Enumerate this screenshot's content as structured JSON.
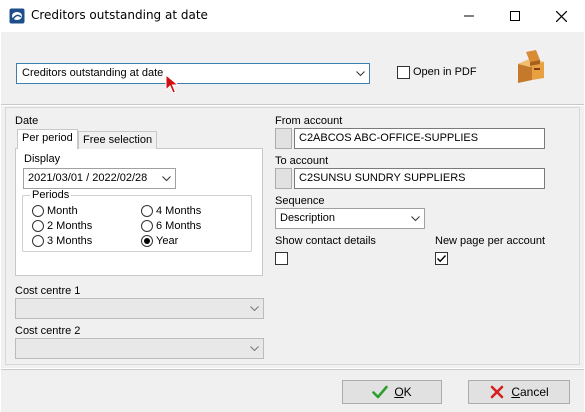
{
  "window": {
    "title": "Creditors outstanding at date",
    "minimize_icon": "minimize-icon",
    "maximize_icon": "maximize-icon",
    "close_icon": "close-icon"
  },
  "report_select": {
    "value": "Creditors outstanding at date"
  },
  "open_in_pdf": {
    "label": "Open in PDF",
    "checked": false
  },
  "date_section": {
    "label": "Date",
    "tabs": [
      {
        "label": "Per period",
        "active": true
      },
      {
        "label": "Free selection",
        "active": false
      }
    ],
    "display_label": "Display",
    "display_value": "2021/03/01 / 2022/02/28",
    "periods_label": "Periods",
    "periods": [
      {
        "label": "Month",
        "selected": false
      },
      {
        "label": "4 Months",
        "selected": false
      },
      {
        "label": "2 Months",
        "selected": false
      },
      {
        "label": "6 Months",
        "selected": false
      },
      {
        "label": "3 Months",
        "selected": false
      },
      {
        "label": "Year",
        "selected": true
      }
    ]
  },
  "cost_centre_1": {
    "label": "Cost centre 1",
    "value": ""
  },
  "cost_centre_2": {
    "label": "Cost centre 2",
    "value": ""
  },
  "from_account": {
    "label": "From account",
    "value": "C2ABCOS ABC-OFFICE-SUPPLIES"
  },
  "to_account": {
    "label": "To account",
    "value": "C2SUNSU SUNDRY SUPPLIERS"
  },
  "sequence": {
    "label": "Sequence",
    "value": "Description"
  },
  "show_contact_details": {
    "label": "Show contact details",
    "checked": false
  },
  "new_page_per_account": {
    "label": "New page per account",
    "checked": true
  },
  "buttons": {
    "ok_accel": "O",
    "ok_rest": "K",
    "cancel_accel": "C",
    "cancel_rest": "ancel"
  },
  "colors": {
    "accent_border": "#3c7fb1",
    "ok_check": "#2e9e2e",
    "cancel_x": "#d42020",
    "cursor_red": "#d01010"
  }
}
